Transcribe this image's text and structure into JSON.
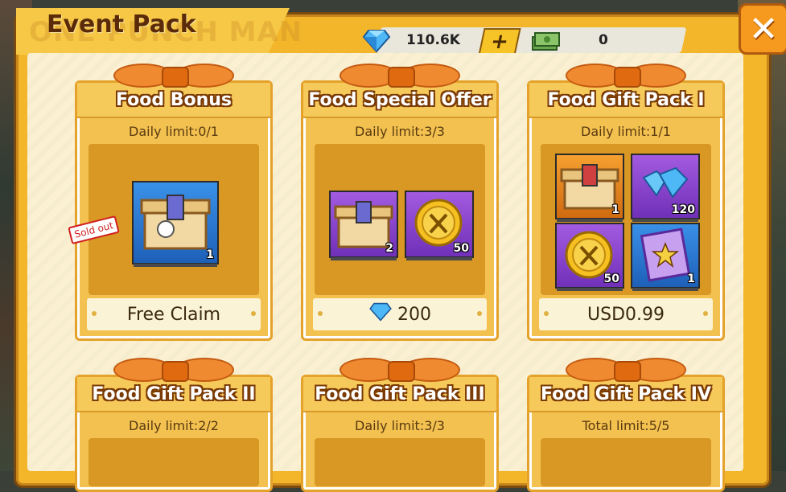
{
  "header": {
    "title": "Event Pack",
    "watermark": "ONE PUNCH MAN"
  },
  "currency": {
    "gems": "110.6K",
    "cash": "0",
    "add_label": "+"
  },
  "close_label": "✕",
  "cards": [
    {
      "title": "Food Bonus",
      "limit": "Daily limit:0/1",
      "price": "Free Claim",
      "sold_out": "Sold out",
      "items": [
        {
          "name": "food-chest",
          "qty": "1",
          "bg": "blue"
        }
      ]
    },
    {
      "title": "Food Special Offer",
      "limit": "Daily limit:3/3",
      "price": "200",
      "items": [
        {
          "name": "food-chest",
          "qty": "2",
          "bg": "purple"
        },
        {
          "name": "food-coin",
          "qty": "50",
          "bg": "purple"
        }
      ]
    },
    {
      "title": "Food Gift Pack I",
      "limit": "Daily limit:1/1",
      "price": "USD0.99",
      "items": [
        {
          "name": "food-chest",
          "qty": "1",
          "bg": "orange"
        },
        {
          "name": "diamonds",
          "qty": "120",
          "bg": "purple"
        },
        {
          "name": "food-coin",
          "qty": "50",
          "bg": "purple"
        },
        {
          "name": "star-ticket",
          "qty": "1",
          "bg": "blue"
        }
      ]
    },
    {
      "title": "Food Gift Pack II",
      "limit": "Daily limit:2/2"
    },
    {
      "title": "Food Gift Pack III",
      "limit": "Daily limit:3/3"
    },
    {
      "title": "Food Gift Pack IV",
      "limit": "Total limit:5/5"
    }
  ]
}
